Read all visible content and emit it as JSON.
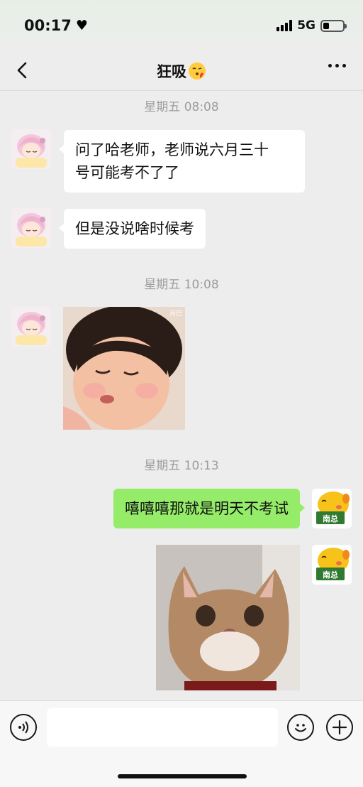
{
  "status_bar": {
    "time": "00:17",
    "network": "5G",
    "battery_level": 0.3
  },
  "chat": {
    "title": "狂吸",
    "title_emoji": "kissing-face-icon"
  },
  "messages": [
    {
      "type": "timestamp",
      "text": "星期五 08:08"
    },
    {
      "type": "text",
      "direction": "in",
      "lines": [
        "问了哈老师，老师说六月三十",
        "号可能考不了了"
      ]
    },
    {
      "type": "text",
      "direction": "in",
      "text": "但是没说啥时候考"
    },
    {
      "type": "timestamp",
      "text": "星期五 10:08"
    },
    {
      "type": "image",
      "direction": "in",
      "description_icon": "baby-sticker-image",
      "watermark": "月巴"
    },
    {
      "type": "timestamp",
      "text": "星期五 10:13"
    },
    {
      "type": "text",
      "direction": "out",
      "text": "嘻嘻嘻那就是明天不考试"
    },
    {
      "type": "image",
      "direction": "out",
      "description_icon": "cat-sticker-image"
    }
  ],
  "avatars": {
    "contact": "anime-girl-avatar",
    "self_label": "南总"
  },
  "colors": {
    "background": "#ededed",
    "incoming_bubble": "#ffffff",
    "outgoing_bubble": "#95ec69",
    "timestamp": "#9d9d9d"
  },
  "input": {
    "value": "",
    "voice_icon": "voice-icon",
    "emoji_icon": "emoji-icon",
    "plus_icon": "plus-icon"
  }
}
